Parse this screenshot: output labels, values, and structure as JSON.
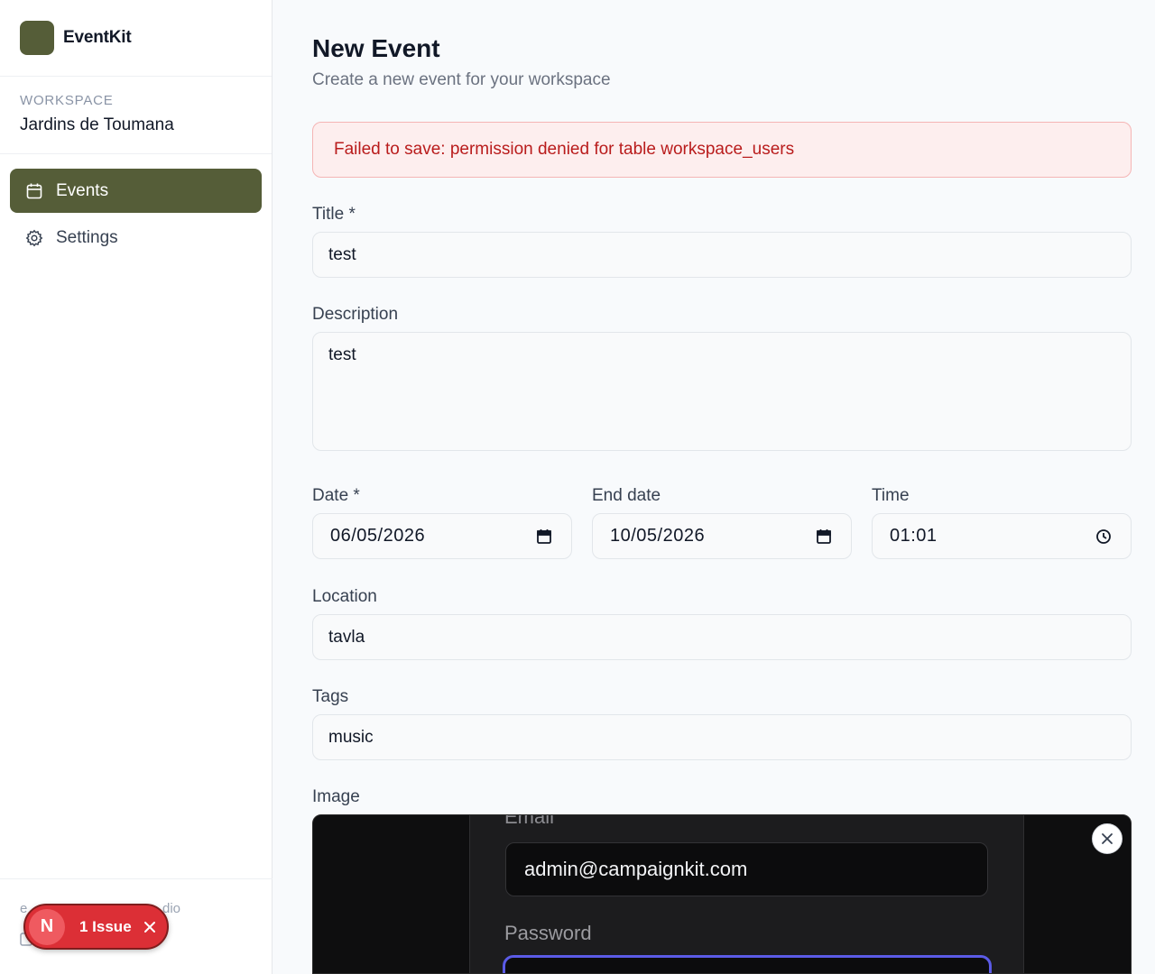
{
  "app": {
    "name": "EventKit"
  },
  "workspace": {
    "label": "WORKSPACE",
    "name": "Jardins de Toumana"
  },
  "sidebar": {
    "items": [
      {
        "label": "Events",
        "icon": "calendar-icon",
        "active": true
      },
      {
        "label": "Settings",
        "icon": "gear-icon",
        "active": false
      }
    ],
    "footer": {
      "line1_start": "e",
      "line1_end": "dio"
    }
  },
  "issue": {
    "badge": "N",
    "label": "1 Issue"
  },
  "page": {
    "title": "New Event",
    "subtitle": "Create a new event for your workspace"
  },
  "alert": {
    "message": "Failed to save: permission denied for table workspace_users"
  },
  "form": {
    "title": {
      "label": "Title *",
      "value": "test"
    },
    "description": {
      "label": "Description",
      "value": "test"
    },
    "date": {
      "label": "Date *",
      "value": "06/05/2026"
    },
    "end_date": {
      "label": "End date",
      "value": "10/05/2026"
    },
    "time": {
      "label": "Time",
      "value": "01:01"
    },
    "location": {
      "label": "Location",
      "value": "tavla"
    },
    "tags": {
      "label": "Tags",
      "value": "music"
    },
    "image": {
      "label": "Image"
    }
  },
  "image_preview": {
    "email_label": "Email",
    "email_value": "admin@campaignkit.com",
    "password_label": "Password"
  },
  "colors": {
    "brand": "#555d38",
    "alert_bg": "#fdeeee",
    "alert_text": "#b91c1c",
    "issue_bg": "#dc2f36"
  }
}
